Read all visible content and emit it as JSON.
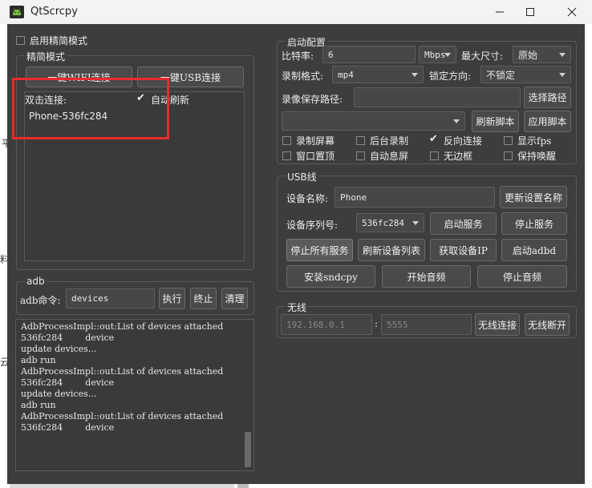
{
  "app": {
    "title": "QtScrcpy"
  },
  "background_fragments": [
    "平",
    "料",
    "云"
  ],
  "simple_mode": {
    "checkbox_label": "启用精简模式",
    "group_title": "精简模式",
    "wifi_button": "一键WIFI连接",
    "usb_button": "一键USB连接",
    "double_click_label": "双击连接:",
    "auto_refresh_label": "自动刷新",
    "devices": [
      "Phone-536fc284"
    ]
  },
  "adb": {
    "group_title": "adb",
    "command_label": "adb命令:",
    "command_value": "devices",
    "execute_button": "执行",
    "stop_button": "终止",
    "clear_button": "清理"
  },
  "log": {
    "lines": [
      "AdbProcessImpl::out:List of devices attached",
      "536fc284        device",
      "",
      "update devices...",
      "adb run",
      "AdbProcessImpl::out:List of devices attached",
      "536fc284        device",
      "",
      "update devices...",
      "adb run",
      "AdbProcessImpl::out:List of devices attached",
      "536fc284        device"
    ]
  },
  "start_config": {
    "group_title": "启动配置",
    "bitrate_label": "比特率:",
    "bitrate_value": "6",
    "bitrate_unit": "Mbps",
    "max_size_label": "最大尺寸:",
    "max_size_value": "原始",
    "record_format_label": "录制格式:",
    "record_format_value": "mp4",
    "lock_direction_label": "锁定方向:",
    "lock_direction_value": "不锁定",
    "record_path_label": "录像保存路径:",
    "record_path_value": "",
    "select_path_button": "选择路径",
    "script_value": "",
    "refresh_script_button": "刷新脚本",
    "apply_script_button": "应用脚本",
    "options": [
      {
        "label": "录制屏幕",
        "checked": false
      },
      {
        "label": "后台录制",
        "checked": false
      },
      {
        "label": "反向连接",
        "checked": true
      },
      {
        "label": "显示fps",
        "checked": false
      },
      {
        "label": "窗口置顶",
        "checked": false
      },
      {
        "label": "自动息屏",
        "checked": false
      },
      {
        "label": "无边框",
        "checked": false
      },
      {
        "label": "保持唤醒",
        "checked": false
      }
    ]
  },
  "usb": {
    "group_title": "USB线",
    "device_name_label": "设备名称:",
    "device_name_value": "Phone",
    "rename_button": "更新设置名称",
    "serial_label": "设备序列号:",
    "serial_value": "536fc284",
    "start_service_button": "启动服务",
    "stop_service_button": "停止服务",
    "stop_all_button": "停止所有服务",
    "refresh_devices_button": "刷新设备列表",
    "get_ip_button": "获取设备IP",
    "start_adbd_button": "启动adbd",
    "install_sndcpy_button": "安装sndcpy",
    "start_audio_button": "开始音频",
    "stop_audio_button": "停止音频"
  },
  "wireless": {
    "group_title": "无线",
    "ip_placeholder": "192.168.0.1",
    "separator": ":",
    "port_placeholder": "5555",
    "connect_button": "无线连接",
    "disconnect_button": "无线断开"
  },
  "colors": {
    "client_bg": "#3d3d3d",
    "annotation_red": "#ec2b2b"
  }
}
